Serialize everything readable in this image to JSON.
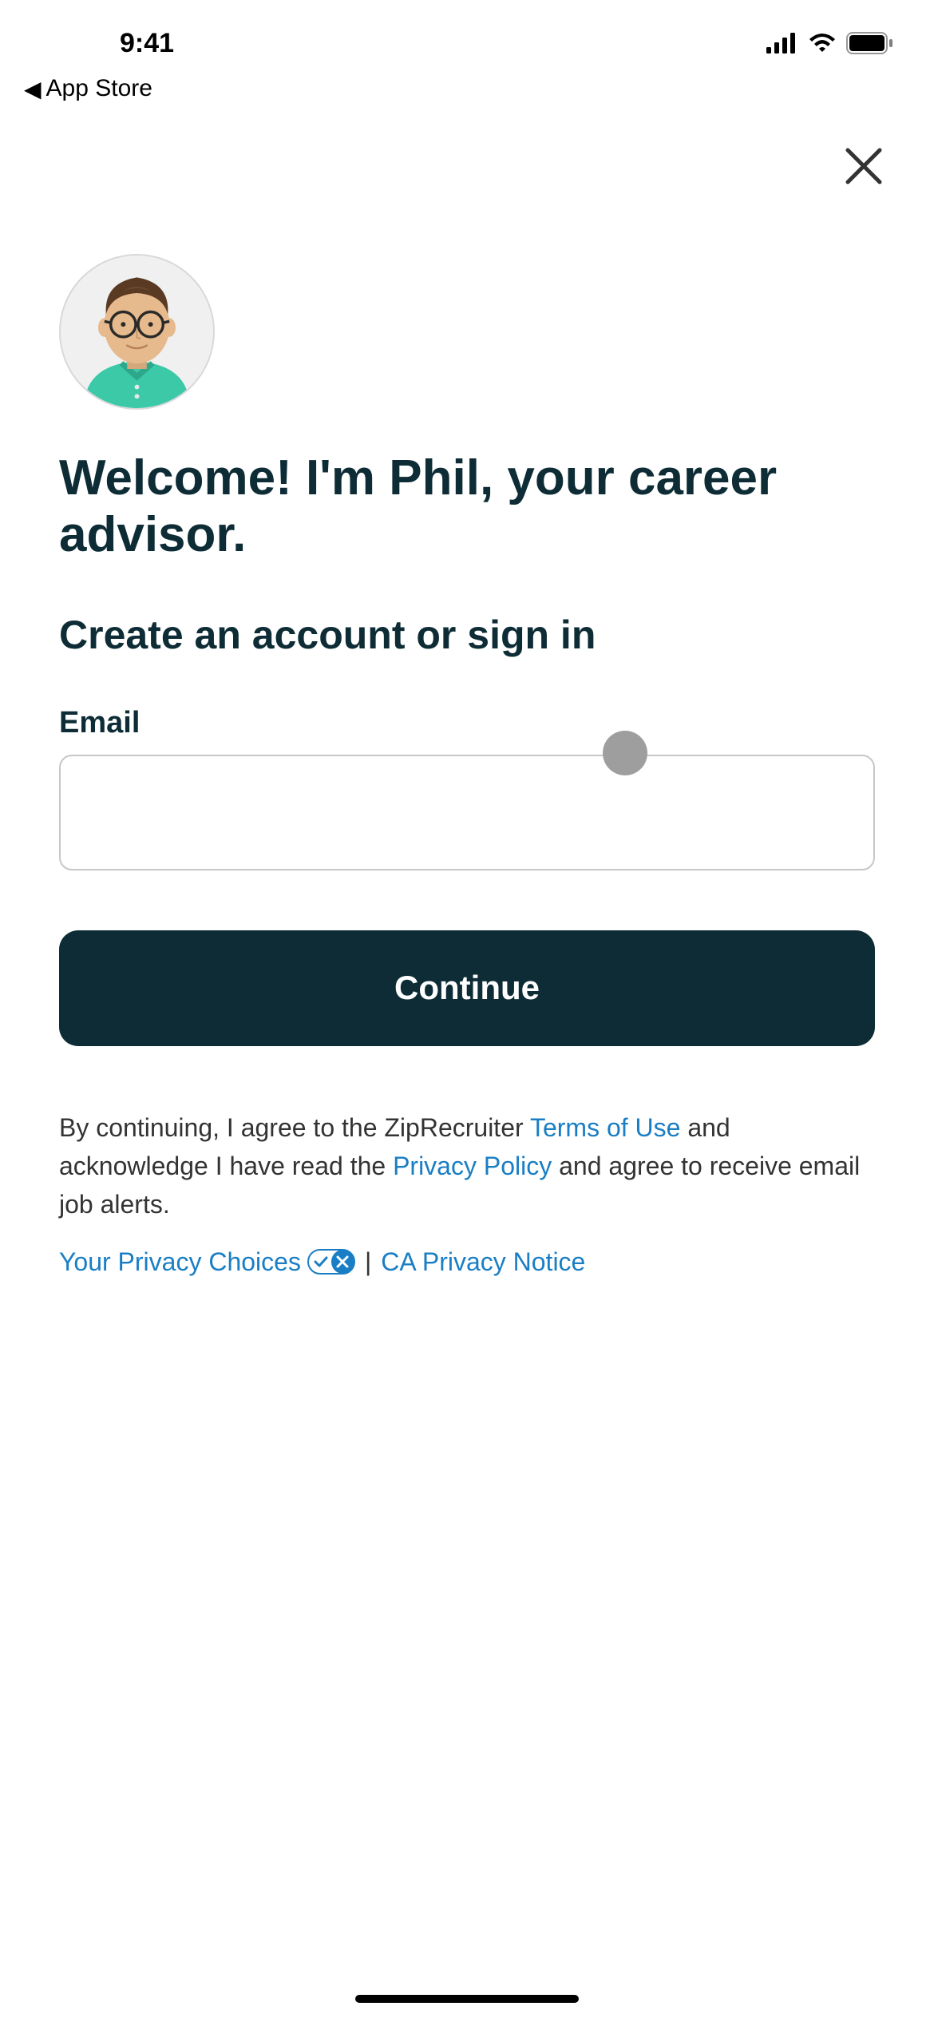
{
  "statusBar": {
    "time": "9:41",
    "backLabel": "App Store"
  },
  "content": {
    "headingMain": "Welcome! I'm Phil, your career advisor.",
    "headingSub": "Create an account or sign in",
    "emailLabel": "Email",
    "emailValue": "",
    "continueLabel": "Continue"
  },
  "legal": {
    "text1": "By continuing, I agree to the ZipRecruiter ",
    "termsLink": "Terms of Use",
    "text2": " and acknowledge I have read the ",
    "privacyLink": "Privacy Policy",
    "text3": " and agree to receive email job alerts.",
    "choicesLink": "Your Privacy Choices",
    "separator": "|",
    "caNoticeLink": "CA Privacy Notice"
  }
}
